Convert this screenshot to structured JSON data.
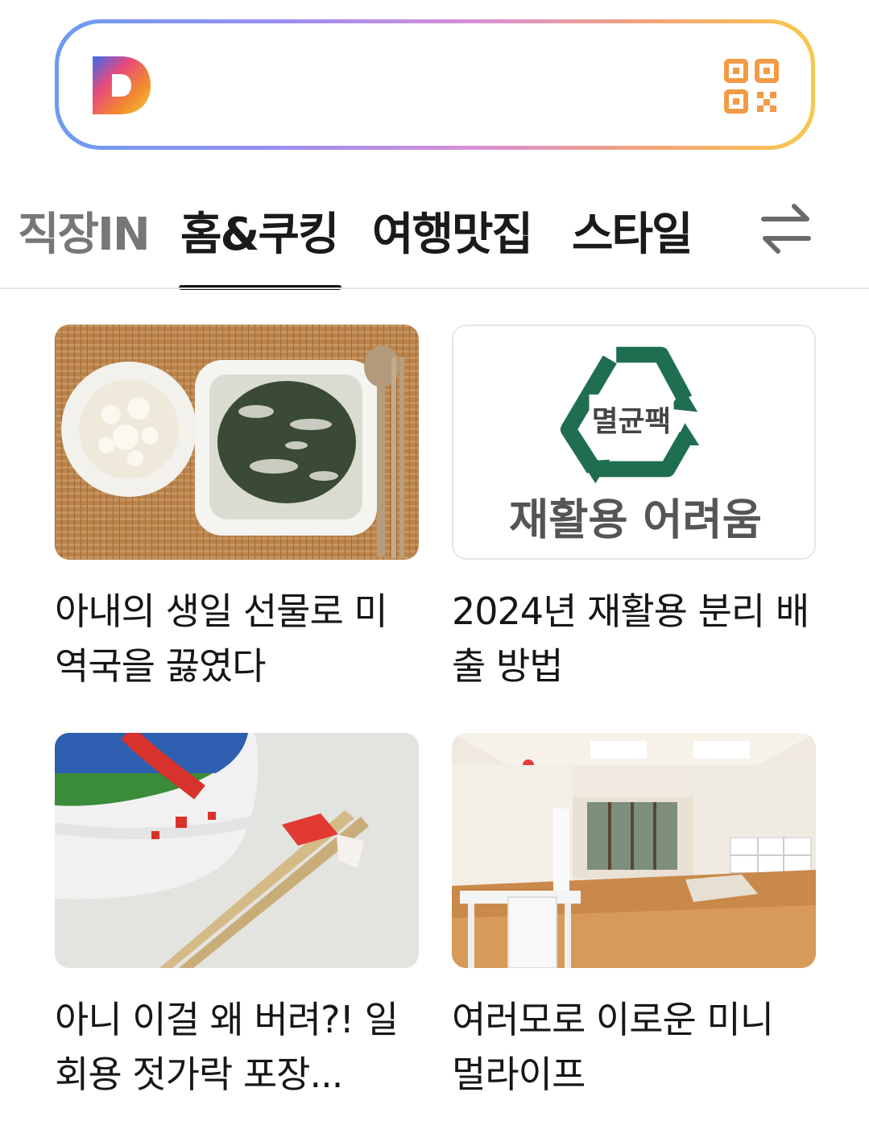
{
  "search": {
    "logo_icon": "daum-logo-icon",
    "qr_icon": "qr-code-icon",
    "placeholder": "",
    "value": "",
    "border_gradient": [
      "#6b9bf0",
      "#d78fd6",
      "#f7c84c"
    ]
  },
  "tabs": [
    {
      "label": "직장IN",
      "active": false
    },
    {
      "label": "홈&쿠킹",
      "active": true
    },
    {
      "label": "여행맛집",
      "active": false
    },
    {
      "label": "스타일",
      "active": false
    }
  ],
  "tabs_swap_icon": "swap-arrows-icon",
  "cards": [
    {
      "image": "seaweed-soup-rice-photo",
      "title": "아내의 생일 선물로 미역국을 끓였다"
    },
    {
      "image": "recycle-sterile-pack-logo",
      "image_text": "멸균팩",
      "image_caption": "재활용 어려움",
      "title": "2024년 재활용 분리 배출 방법"
    },
    {
      "image": "cup-noodle-chopsticks-photo",
      "title": "아니 이걸 왜 버려?! 일회용 젓가락 포장..."
    },
    {
      "image": "empty-living-room-photo",
      "title": "여러모로 이로운 미니 멀라이프"
    }
  ],
  "colors": {
    "accent_underline": "#111111",
    "recycle_green": "#1f6e4f"
  }
}
